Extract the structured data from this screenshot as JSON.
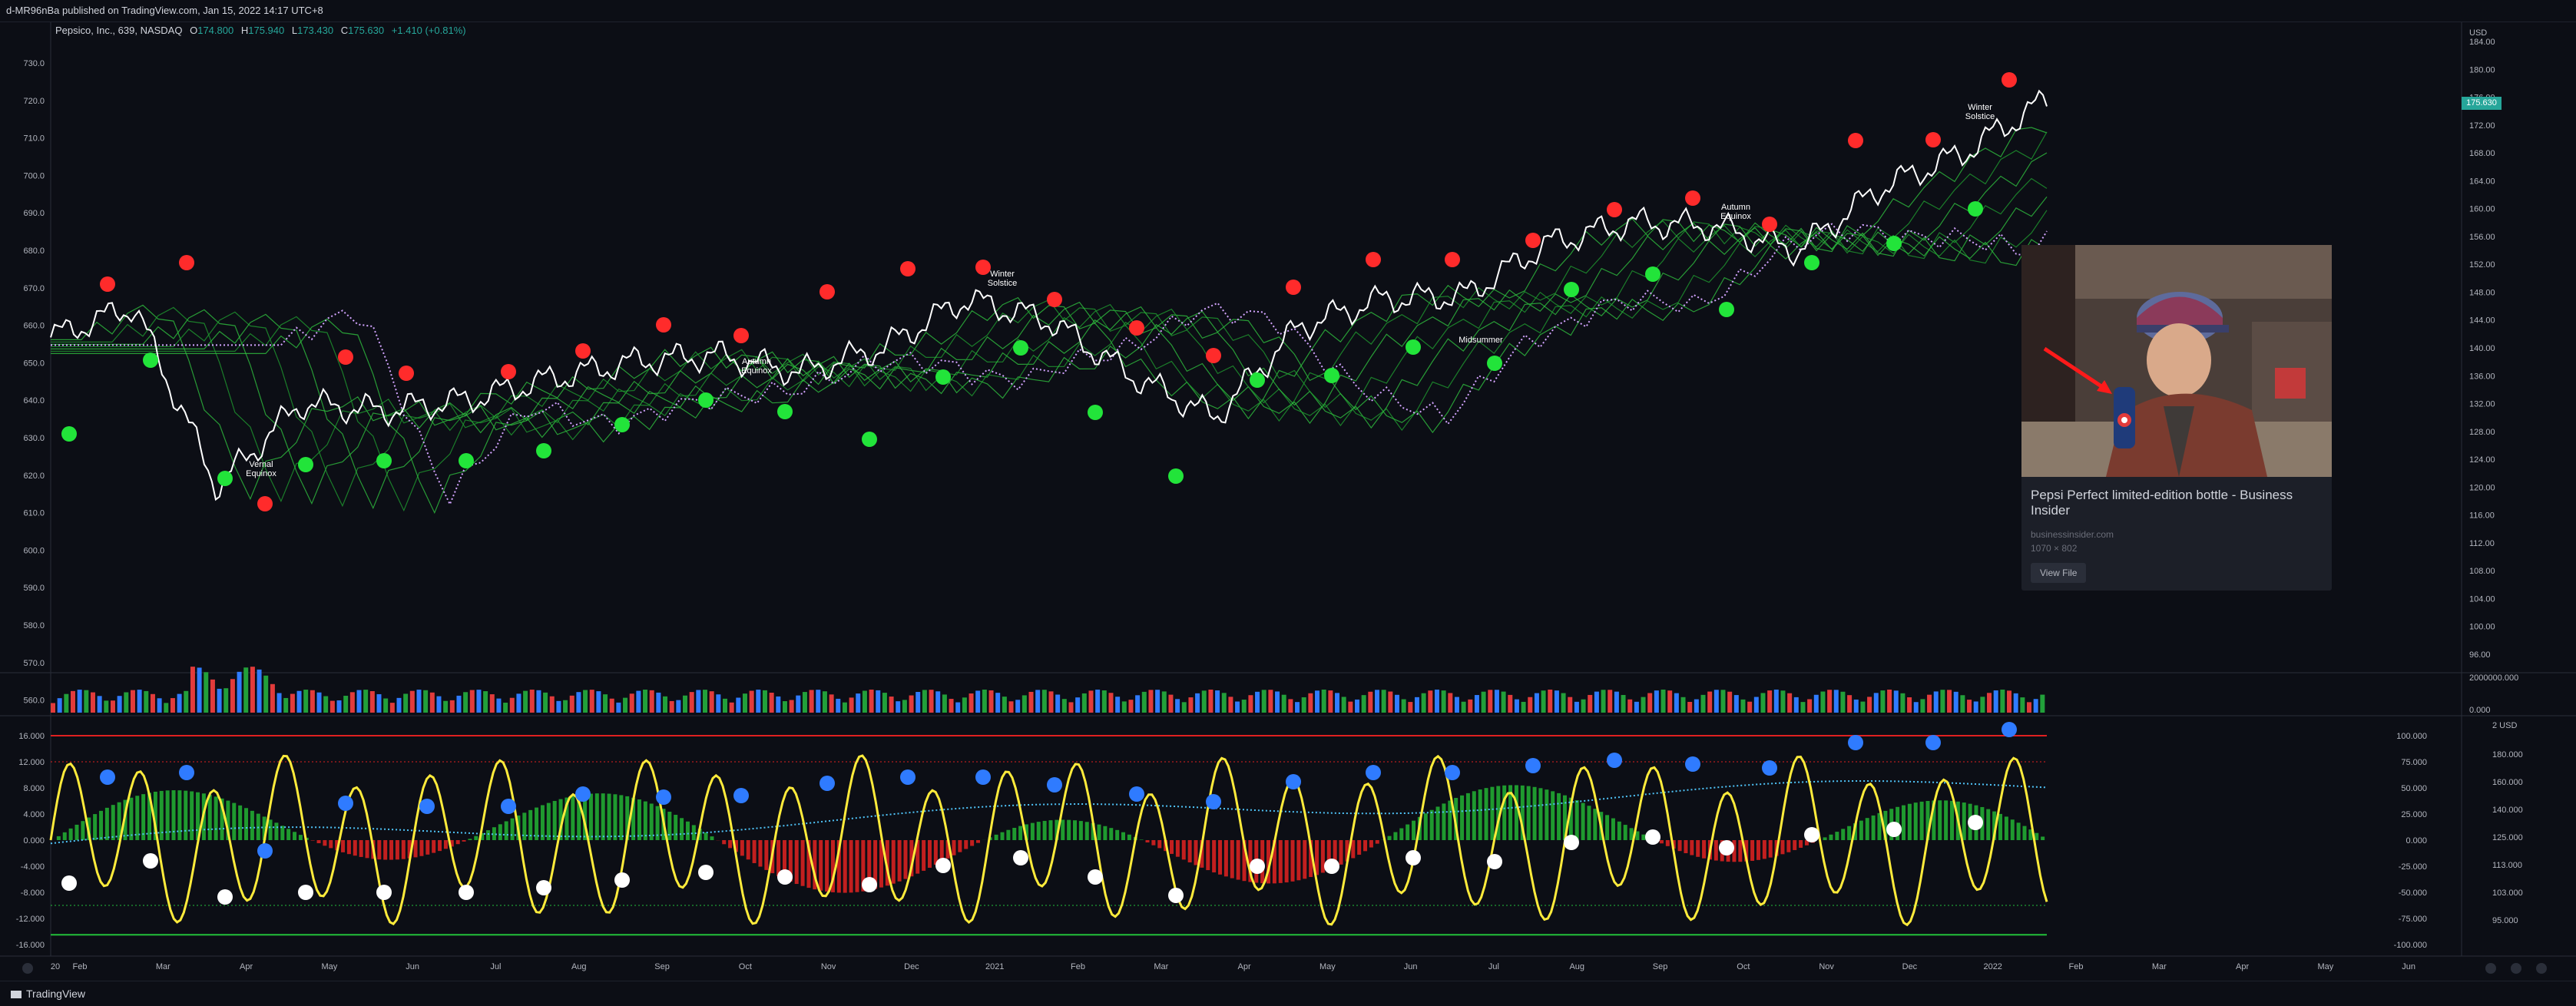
{
  "header": {
    "published": "d-MR96nBa published on TradingView.com, Jan 15, 2022 14:17 UTC+8"
  },
  "legend": {
    "symbol": "Pepsico, Inc., 639, NASDAQ",
    "open_label": "O",
    "open": "174.800",
    "high_label": "H",
    "high": "175.940",
    "low_label": "L",
    "low": "173.430",
    "close_label": "C",
    "close": "175.630",
    "change": "+1.410 (+0.81%)"
  },
  "price_tag": "175.630",
  "left_price_axis": [
    "730.0",
    "720.0",
    "710.0",
    "700.0",
    "690.0",
    "680.0",
    "670.0",
    "660.0",
    "650.0",
    "640.0",
    "630.0",
    "620.0",
    "610.0",
    "600.0",
    "590.0",
    "580.0",
    "570.0",
    "560.0"
  ],
  "right_price_axis": [
    "USD",
    "184.00",
    "180.00",
    "176.00",
    "172.00",
    "168.00",
    "164.00",
    "160.00",
    "156.00",
    "152.00",
    "148.00",
    "144.00",
    "140.00",
    "136.00",
    "132.00",
    "128.00",
    "124.00",
    "120.00",
    "116.00",
    "112.00",
    "108.00",
    "104.00",
    "100.00",
    "96.00"
  ],
  "volume_axis": [
    "2000000.000",
    "0.000"
  ],
  "osc_left_axis": [
    "16.000",
    "12.000",
    "8.000",
    "4.000",
    "0.000",
    "-4.000",
    "-8.000",
    "-12.000",
    "-16.000"
  ],
  "osc_right_axis": [
    "100.000",
    "75.000",
    "50.000",
    "25.000",
    "0.000",
    "-25.000",
    "-50.000",
    "-75.000",
    "-100.000"
  ],
  "osc_right_axis2": [
    "2 USD",
    "180.000",
    "160.000",
    "140.000",
    "125.000",
    "113.000",
    "103.000",
    "95.000"
  ],
  "x_axis": [
    "20",
    "Feb",
    "Mar",
    "Apr",
    "May",
    "Jun",
    "Jul",
    "Aug",
    "Sep",
    "Oct",
    "Nov",
    "Dec",
    "2021",
    "Feb",
    "Mar",
    "Apr",
    "May",
    "Jun",
    "Jul",
    "Aug",
    "Sep",
    "Oct",
    "Nov",
    "Dec",
    "2022",
    "Feb",
    "Mar",
    "Apr",
    "May",
    "Jun"
  ],
  "annotations": [
    {
      "text": "Vernal Equinox"
    },
    {
      "text": "Autumn Equinox"
    },
    {
      "text": "Winter Solstice"
    },
    {
      "text": "Midsummer"
    },
    {
      "text": "Autumn Equinox"
    },
    {
      "text": "Winter Solstice"
    }
  ],
  "image_popup": {
    "title": "Pepsi Perfect limited-edition bottle - Business Insider",
    "domain": "businessinsider.com",
    "size": "1070 × 802",
    "button": "View File"
  },
  "footer": {
    "brand": "TradingView"
  },
  "colors": {
    "background": "#0c0e15",
    "up": "#26a69a",
    "red_dot": "#ff2b2b",
    "green_dot": "#22e43a",
    "blue_dot": "#2f7bff",
    "oscillator": "#ffeb3b",
    "ribbon_up": "#2fbf3f",
    "ribbon_down": "#8b1b1b"
  },
  "chart_data": {
    "type": "line",
    "title": "Pepsico, Inc., 639, NASDAQ",
    "x": [
      "2020-01",
      "2020-02",
      "2020-03",
      "2020-04",
      "2020-05",
      "2020-06",
      "2020-07",
      "2020-08",
      "2020-09",
      "2020-10",
      "2020-11",
      "2020-12",
      "2021-01",
      "2021-02",
      "2021-03",
      "2021-04",
      "2021-05",
      "2021-06",
      "2021-07",
      "2021-08",
      "2021-09",
      "2021-10",
      "2021-11",
      "2021-12",
      "2022-01"
    ],
    "series": [
      {
        "values": [
          141.5,
          146.0,
          120.0,
          132.0,
          131.0,
          132.5,
          135.5,
          138.0,
          139.0,
          136.5,
          140.0,
          147.0,
          144.0,
          136.0,
          130.0,
          143.0,
          147.0,
          147.5,
          155.0,
          158.0,
          157.5,
          154.0,
          163.0,
          168.0,
          175.63
        ]
      }
    ],
    "ylim": [
      94,
      186
    ],
    "volume_ylim": [
      0,
      2000000
    ],
    "oscillator_ylim": [
      -16,
      16
    ]
  }
}
